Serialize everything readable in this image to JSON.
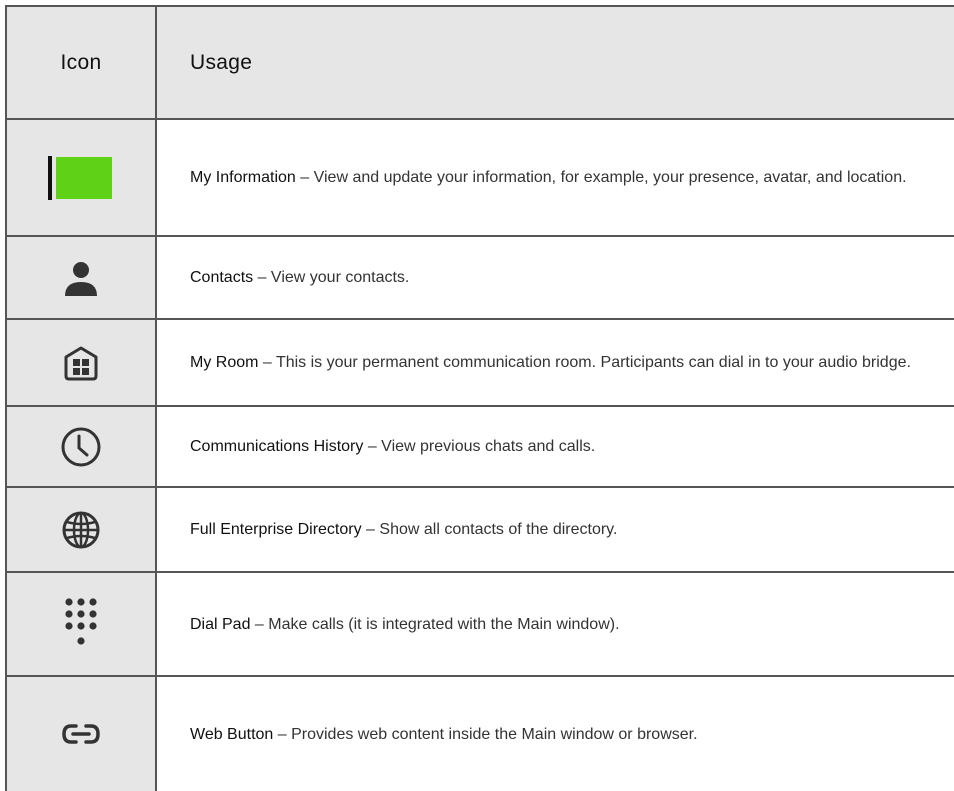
{
  "header": {
    "icon_col": "Icon",
    "usage_col": "Usage"
  },
  "rows": [
    {
      "icon": "flag-icon",
      "term": "My Information",
      "text": " – View and update your information, for example, your presence, avatar, and location."
    },
    {
      "icon": "contact-person-icon",
      "term": "Contacts",
      "text": " – View your contacts."
    },
    {
      "icon": "room-building-icon",
      "term": "My Room",
      "text": " – This is your permanent communication room. Participants can dial in to your audio bridge."
    },
    {
      "icon": "clock-icon",
      "term": "Communications History",
      "text": " – View previous chats and calls."
    },
    {
      "icon": "globe-icon",
      "term": "Full Enterprise Directory",
      "text": " – Show all contacts of the directory."
    },
    {
      "icon": "dial-pad-icon",
      "term": "Dial Pad",
      "text": " – Make calls (it is integrated with the Main window)."
    },
    {
      "icon": "link-icon",
      "term": "Web Button",
      "text": " – Provides web content inside the Main window or browser."
    }
  ],
  "colors": {
    "flag_green": "#5fd116",
    "icon_gray": "#333333",
    "header_bg": "#e6e6e6"
  }
}
